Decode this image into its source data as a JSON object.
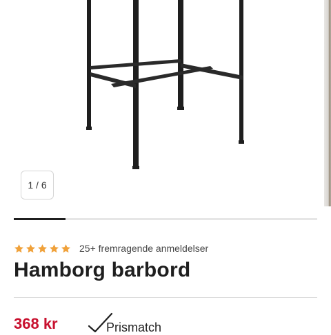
{
  "gallery": {
    "counter": "1 / 6",
    "progress": 0.17
  },
  "product": {
    "rating": {
      "stars": 5,
      "text": "25+ fremragende anmeldelser",
      "star_color": "#f0a13a"
    },
    "title": "Hamborg barbord",
    "price": "368 kr",
    "badge": "Prismatch",
    "price_color": "#c8102e"
  },
  "icons": {
    "star": "star-icon",
    "check": "checkmark-icon"
  }
}
